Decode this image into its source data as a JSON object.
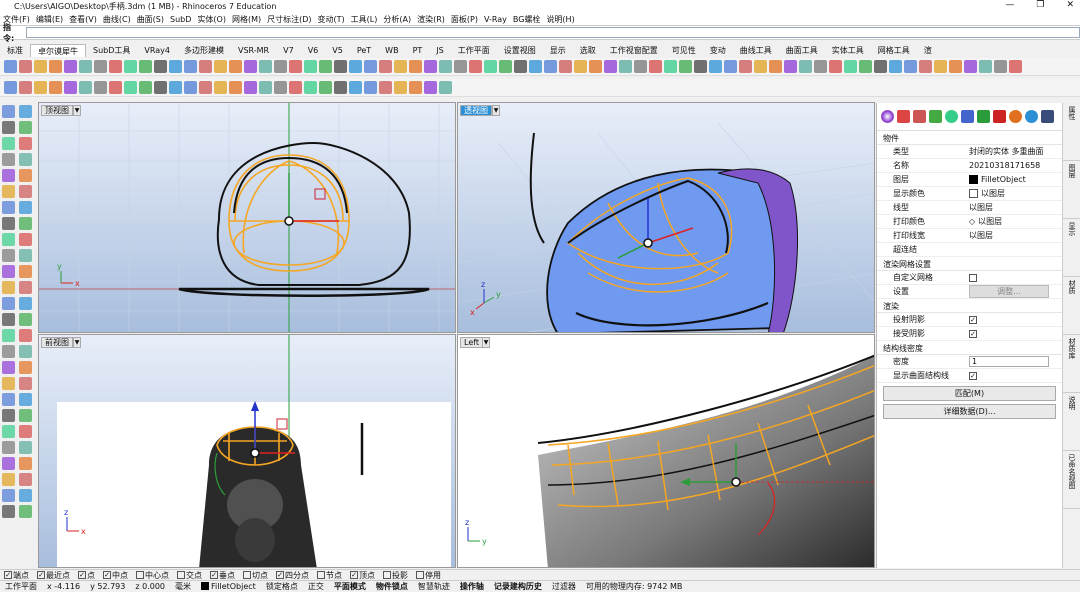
{
  "window": {
    "title": "C:\\Users\\AIGO\\Desktop\\手柄.3dm (1 MB) - Rhinoceros 7 Education",
    "controls": [
      "—",
      "❐",
      "✕"
    ]
  },
  "menu": [
    "文件(F)",
    "编辑(E)",
    "查看(V)",
    "曲线(C)",
    "曲面(S)",
    "SubD",
    "实体(O)",
    "网格(M)",
    "尺寸标注(D)",
    "变动(T)",
    "工具(L)",
    "分析(A)",
    "渲染(R)",
    "面板(P)",
    "V-Ray",
    "BG螺栓",
    "说明(H)"
  ],
  "command": {
    "label": "指令:",
    "value": ""
  },
  "tabs": [
    "标准",
    "卓尔谟犀牛",
    "SubD工具",
    "VRay4",
    "多边形建模",
    "VSR-MR",
    "V7",
    "V6",
    "V5",
    "PeT",
    "WB",
    "PT",
    "JS",
    "工作平面",
    "设置视图",
    "显示",
    "选取",
    "工作视窗配置",
    "可见性",
    "变动",
    "曲线工具",
    "曲面工具",
    "实体工具",
    "网格工具",
    "渲"
  ],
  "active_tab": "卓尔谟犀牛",
  "viewports": {
    "top": {
      "label": "顶视图"
    },
    "perspective": {
      "label": "透视图"
    },
    "front": {
      "label": "前视图"
    },
    "left": {
      "label": "Left"
    }
  },
  "axes": {
    "x": "x",
    "y": "y",
    "z": "z"
  },
  "properties": {
    "header": "物件",
    "rows": [
      {
        "key": "类型",
        "value": "封闭的实体 多重曲面"
      },
      {
        "key": "名称",
        "value": "20210318171658"
      },
      {
        "key": "图层",
        "value": "FilletObject"
      },
      {
        "key": "显示颜色",
        "value": "以图层"
      },
      {
        "key": "线型",
        "value": "以图层"
      },
      {
        "key": "打印颜色",
        "value": "以图层"
      },
      {
        "key": "打印线宽",
        "value": "以图层"
      },
      {
        "key": "超连结",
        "value": ""
      }
    ],
    "render_mesh_header": "渲染网格设置",
    "custom_mesh": "自定义网格",
    "settings_label": "设置",
    "adjust_button": "调整...",
    "render_header": "渲染",
    "cast_shadows": "投射阴影",
    "receive_shadows": "接受阴影",
    "isocurve_header": "结构线密度",
    "density_label": "密度",
    "density_value": "1",
    "show_isocurves": "显示曲面结构线",
    "match_button": "匹配(M)",
    "details_button": "详细数据(D)..."
  },
  "right_tabs": [
    "属性",
    "图层",
    "显示",
    "材质",
    "材质库",
    "说明",
    "已命名视图"
  ],
  "osnap": [
    {
      "label": "端点",
      "checked": true
    },
    {
      "label": "最近点",
      "checked": true
    },
    {
      "label": "点",
      "checked": true
    },
    {
      "label": "中点",
      "checked": true
    },
    {
      "label": "中心点",
      "checked": false
    },
    {
      "label": "交点",
      "checked": false
    },
    {
      "label": "垂点",
      "checked": true
    },
    {
      "label": "切点",
      "checked": false
    },
    {
      "label": "四分点",
      "checked": true
    },
    {
      "label": "节点",
      "checked": false
    },
    {
      "label": "顶点",
      "checked": true
    },
    {
      "label": "投影",
      "checked": false
    },
    {
      "label": "停用",
      "checked": false
    }
  ],
  "status": {
    "cplane": "工作平面",
    "x": "x -4.116",
    "y": "y 52.793",
    "z": "z 0.000",
    "unit": "毫米",
    "layer": "FilletObject",
    "items": [
      "锁定格点",
      "正交",
      "平面模式",
      "物件锁点",
      "智慧轨迹",
      "操作轴",
      "记录建构历史",
      "过滤器"
    ],
    "memory": "可用的物理内存: 9742 MB"
  },
  "colors": {
    "accent": "#2b8fd6",
    "curve": "#f5a623",
    "surface": "#6f9af0"
  }
}
